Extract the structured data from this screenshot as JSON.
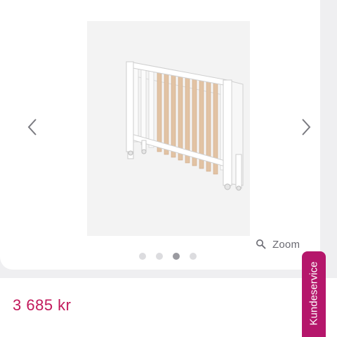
{
  "gallery": {
    "image_alt": "Folding baby crib",
    "zoom_label": "Zoom",
    "slide_count": 4,
    "active_slide": 3
  },
  "product": {
    "price": "3 685 kr"
  },
  "service_tab": {
    "label": "Kundeservice"
  },
  "colors": {
    "accent": "#c2185b",
    "tab_bg": "#b5166b"
  },
  "icons": [
    "chevron-left-icon",
    "chevron-right-icon",
    "magnifier-icon"
  ]
}
